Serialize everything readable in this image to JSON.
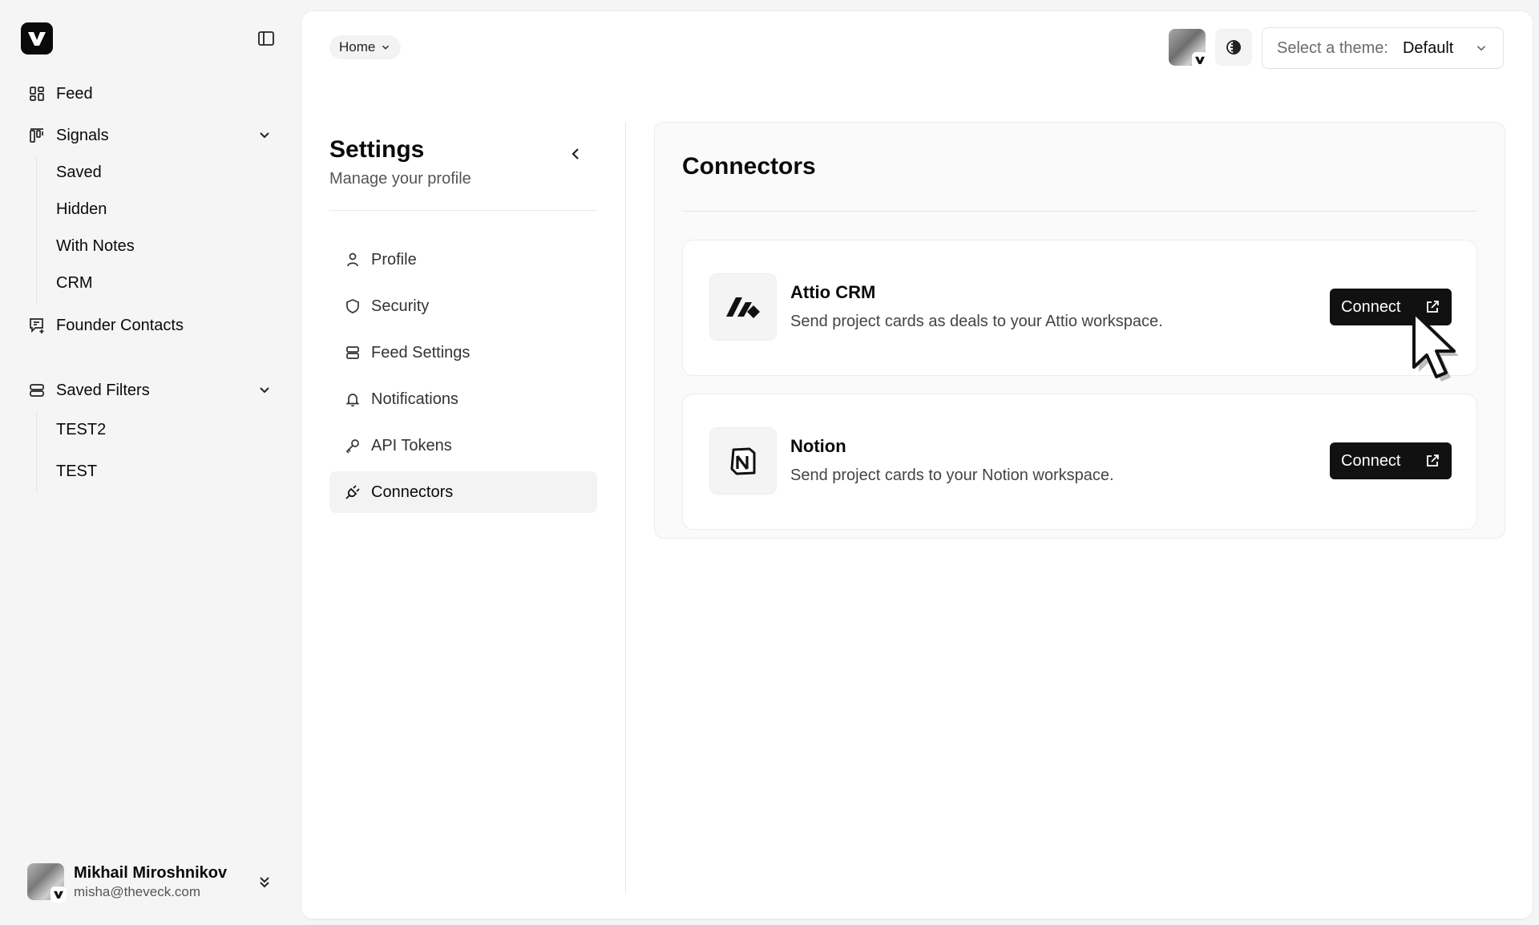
{
  "sidebar": {
    "nav": [
      {
        "label": "Feed"
      },
      {
        "label": "Signals"
      },
      {
        "label": "Founder Contacts"
      },
      {
        "label": "Saved Filters"
      }
    ],
    "signals_sub": [
      "Saved",
      "Hidden",
      "With Notes",
      "CRM"
    ],
    "filters_sub": [
      "TEST2",
      "TEST"
    ],
    "user": {
      "name": "Mikhail Miroshnikov",
      "email": "misha@theveck.com"
    }
  },
  "header": {
    "breadcrumb": "Home",
    "theme_label": "Select a theme:",
    "theme_value": "Default"
  },
  "settings": {
    "title": "Settings",
    "subtitle": "Manage your profile",
    "menu": [
      {
        "label": "Profile",
        "icon": "user-icon"
      },
      {
        "label": "Security",
        "icon": "shield-icon"
      },
      {
        "label": "Feed Settings",
        "icon": "stack-icon"
      },
      {
        "label": "Notifications",
        "icon": "bell-icon"
      },
      {
        "label": "API Tokens",
        "icon": "key-icon"
      },
      {
        "label": "Connectors",
        "icon": "plug-icon",
        "active": true
      }
    ]
  },
  "connectors": {
    "title": "Connectors",
    "items": [
      {
        "name": "Attio CRM",
        "description": "Send project cards as deals to your Attio workspace.",
        "button": "Connect"
      },
      {
        "name": "Notion",
        "description": "Send project cards to your Notion workspace.",
        "button": "Connect"
      }
    ]
  },
  "colors": {
    "accent": "#111111",
    "background": "#f5f5f5",
    "panel": "#ffffff"
  }
}
